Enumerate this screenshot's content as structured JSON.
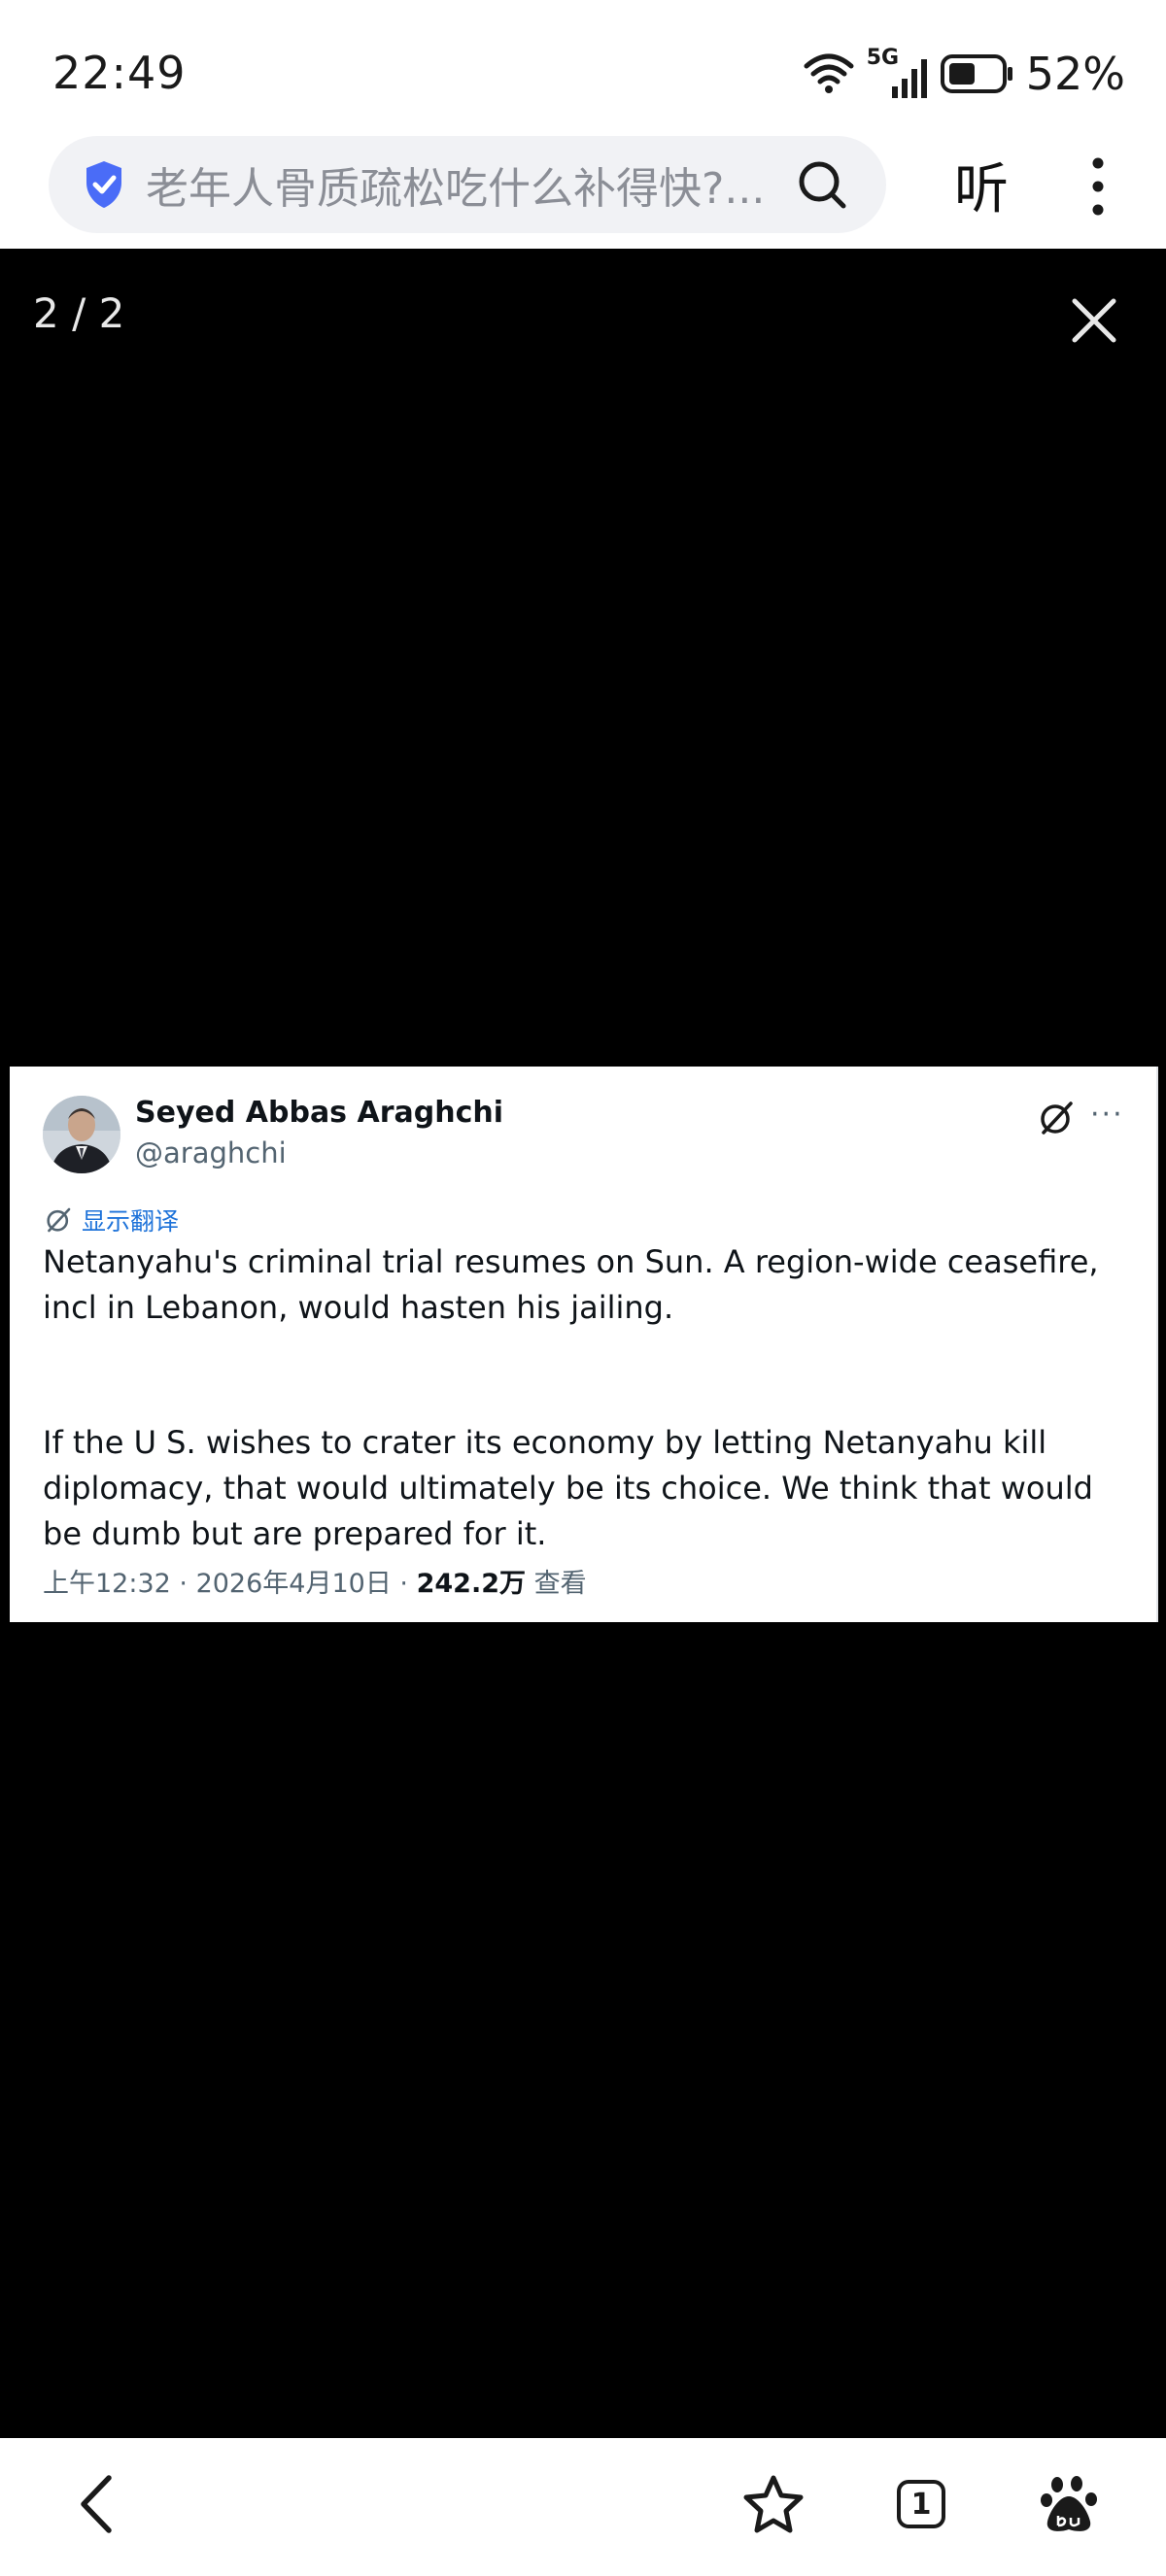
{
  "status_bar": {
    "time": "22:49",
    "network": "5G",
    "battery_percent": "52%",
    "battery_level": 0.52
  },
  "browser": {
    "address_text": "老年人骨质疏松吃什么补得快?...",
    "listen_label": "听"
  },
  "viewer": {
    "counter": "2 / 2"
  },
  "tweet": {
    "author_name": "Seyed Abbas Araghchi",
    "handle": "@araghchi",
    "translate_label": "显示翻译",
    "paragraph_1": "Netanyahu's criminal trial resumes on Sun. A region-wide ceasefire, incl in Lebanon, would hasten his jailing.",
    "paragraph_2": "If the U S. wishes to crater its economy by letting Netanyahu kill diplomacy, that would ultimately be its choice. We think that would be dumb but are prepared for it.",
    "time": "上午12:32",
    "date": "2026年4月10日",
    "views": "242.2万",
    "views_label": "查看",
    "more_label": "···"
  },
  "bottom_nav": {
    "tab_count": "1"
  },
  "colors": {
    "accent_blue": "#4a6cf7",
    "link_blue": "#1d72d9",
    "viewer_bg": "#000000"
  }
}
